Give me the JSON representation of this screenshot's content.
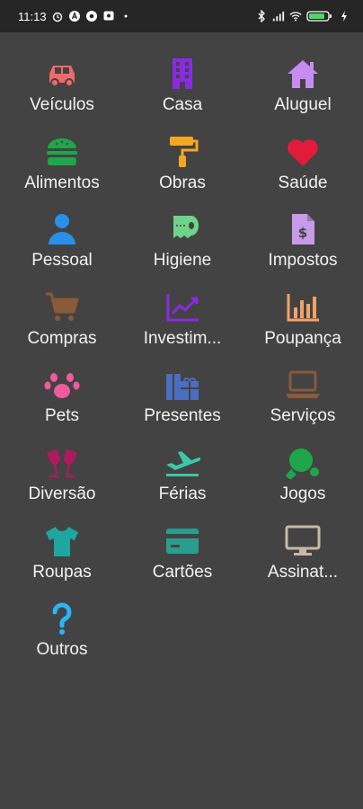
{
  "status": {
    "time": "11:13",
    "battery": "82"
  },
  "categories": [
    {
      "label": "Veículos",
      "icon": "car-icon",
      "color": "#f0696b"
    },
    {
      "label": "Casa",
      "icon": "building-icon",
      "color": "#8a2be2"
    },
    {
      "label": "Aluguel",
      "icon": "house-icon",
      "color": "#c78cf0"
    },
    {
      "label": "Alimentos",
      "icon": "burger-icon",
      "color": "#1fa64a"
    },
    {
      "label": "Obras",
      "icon": "paint-roller-icon",
      "color": "#f5a623"
    },
    {
      "label": "Saúde",
      "icon": "heart-icon",
      "color": "#e21b3c"
    },
    {
      "label": "Pessoal",
      "icon": "person-icon",
      "color": "#2a8fe8"
    },
    {
      "label": "Higiene",
      "icon": "toilet-paper-icon",
      "color": "#6ed48a"
    },
    {
      "label": "Impostos",
      "icon": "tax-document-icon",
      "color": "#c79be8"
    },
    {
      "label": "Compras",
      "icon": "shopping-cart-icon",
      "color": "#8a5a3a"
    },
    {
      "label": "Investim...",
      "icon": "chart-line-icon",
      "color": "#8a2be2"
    },
    {
      "label": "Poupança",
      "icon": "bar-chart-icon",
      "color": "#f0a36a"
    },
    {
      "label": "Pets",
      "icon": "paw-icon",
      "color": "#ef5b9c"
    },
    {
      "label": "Presentes",
      "icon": "gifts-icon",
      "color": "#4a6fc0"
    },
    {
      "label": "Serviços",
      "icon": "laptop-icon",
      "color": "#8a5a3a"
    },
    {
      "label": "Diversão",
      "icon": "glasses-cheers-icon",
      "color": "#b0195f"
    },
    {
      "label": "Férias",
      "icon": "plane-icon",
      "color": "#3ec6a8"
    },
    {
      "label": "Jogos",
      "icon": "ping-pong-icon",
      "color": "#1fa64a"
    },
    {
      "label": "Roupas",
      "icon": "tshirt-icon",
      "color": "#1fa6a0"
    },
    {
      "label": "Cartões",
      "icon": "credit-card-icon",
      "color": "#2a9d8f"
    },
    {
      "label": "Assinat...",
      "icon": "monitor-icon",
      "color": "#c8b8a6"
    },
    {
      "label": "Outros",
      "icon": "question-icon",
      "color": "#29b6f6"
    }
  ]
}
